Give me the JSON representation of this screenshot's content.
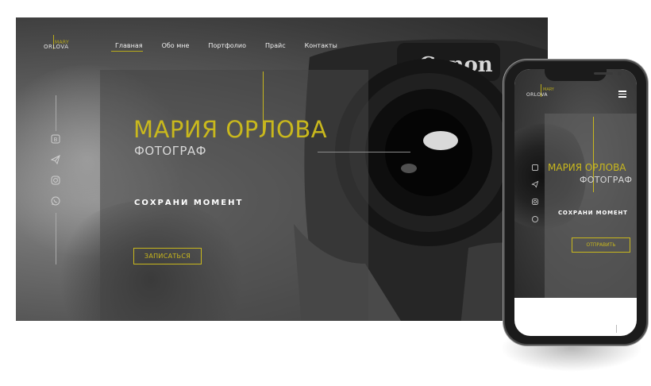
{
  "desktop": {
    "logo": {
      "top": "MARY",
      "bottom": "ORLOVA"
    },
    "nav": [
      "Главная",
      "Обо мне",
      "Портфолио",
      "Прайс",
      "Контакты"
    ],
    "title": "МАРИЯ ОРЛОВА",
    "subtitle": "ФОТОГРАФ",
    "tagline": "СОХРАНИ МОМЕНТ",
    "cta": "ЗАПИСАТЬСЯ",
    "camera_brand": "Canon",
    "social_icons": [
      "vk-icon",
      "telegram-icon",
      "instagram-icon",
      "whatsapp-icon"
    ]
  },
  "mobile": {
    "logo": {
      "top": "MARY",
      "bottom": "ORLOVA"
    },
    "title": "МАРИЯ ОРЛОВА",
    "subtitle": "ФОТОГРАФ",
    "tagline": "СОХРАНИ МОМЕНТ",
    "cta": "ОТПРАВИТЬ",
    "social_icons": [
      "vk-icon",
      "telegram-icon",
      "instagram-icon",
      "whatsapp-icon"
    ]
  },
  "colors": {
    "accent": "#c9b81d",
    "text_light": "#f0f0f0"
  }
}
